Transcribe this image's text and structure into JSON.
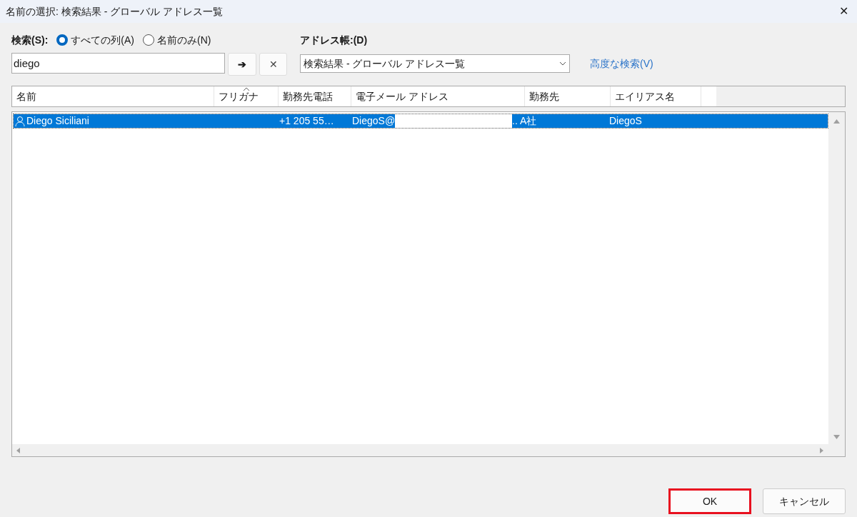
{
  "window": {
    "title": "名前の選択: 検索結果 - グローバル アドレス一覧",
    "close": "✕"
  },
  "search": {
    "label": "検索(S):",
    "options": [
      {
        "label": "すべての列(A)",
        "selected": true
      },
      {
        "label": "名前のみ(N)",
        "selected": false
      }
    ],
    "value": "diego",
    "go": "➔",
    "clear": "✕"
  },
  "address_book": {
    "label": "アドレス帳:(D)",
    "value": "検索結果 - グローバル アドレス一覧",
    "advanced": "高度な検索(V)"
  },
  "table": {
    "columns": [
      {
        "label": "名前",
        "sorted": false
      },
      {
        "label": "フリガナ",
        "sorted": true
      },
      {
        "label": "勤務先電話",
        "sorted": false
      },
      {
        "label": "電子メール アドレス",
        "sorted": false
      },
      {
        "label": "勤務先",
        "sorted": false
      },
      {
        "label": "エイリアス名",
        "sorted": false
      }
    ],
    "rows": [
      {
        "name": "Diego Siciliani",
        "phone": "+1 205 55…",
        "email": "DiegoS@",
        "company": ".. A社",
        "alias": "DiegoS",
        "selected": true
      }
    ]
  },
  "buttons": [
    {
      "label": "OK",
      "highlighted": true
    },
    {
      "label": "キャンセル",
      "highlighted": false
    }
  ]
}
